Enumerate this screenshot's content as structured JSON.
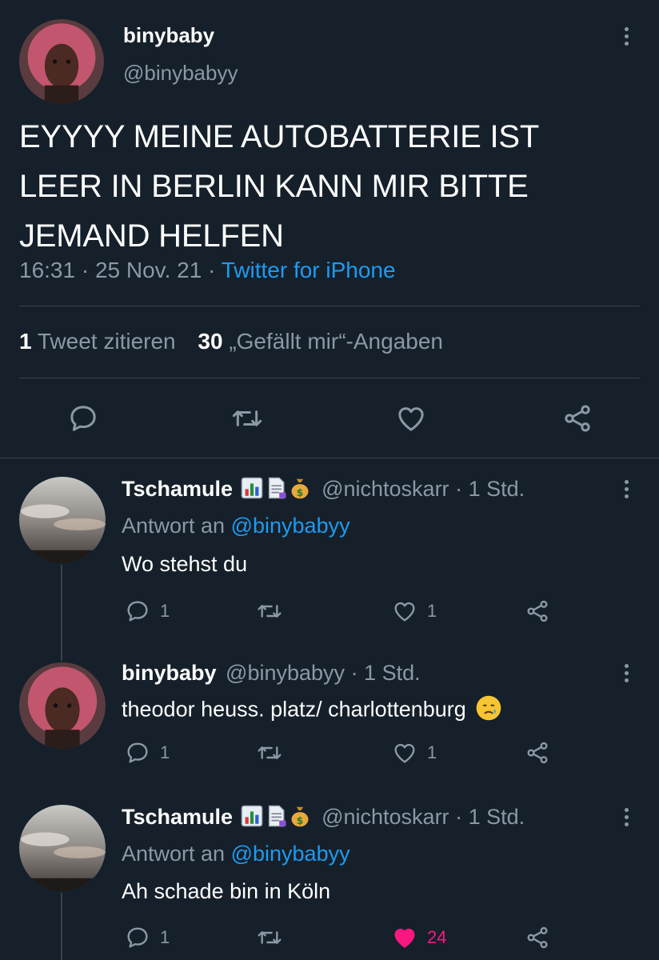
{
  "main_tweet": {
    "display_name": "binybaby",
    "handle": "@binybabyy",
    "text_lines": [
      "EYYYY MEINE AUTOBATTERIE IST",
      "LEER IN BERLIN KANN MIR BITTE",
      "JEMAND HELFEN"
    ],
    "time": "16:31",
    "separator": "·",
    "date": "25 Nov. 21",
    "source": "Twitter for iPhone",
    "stats": {
      "quotes_count": "1",
      "quotes_label": "Tweet zitieren",
      "likes_count": "30",
      "likes_label": "„Gefällt mir“-Angaben"
    }
  },
  "replies": [
    {
      "display_name": "Tschamule",
      "handle": "@nichtoskarr",
      "time": "· 1 Std.",
      "reply_to_label": "Antwort an",
      "reply_to_handle": "@binybabyy",
      "text": "Wo stehst du",
      "reply_count": "1",
      "like_count": "1",
      "liked": false
    },
    {
      "display_name": "binybaby",
      "handle": "@binybabyy",
      "time": "· 1 Std.",
      "text": "theodor heuss. platz/ charlottenburg",
      "reply_count": "1",
      "like_count": "1",
      "liked": false
    },
    {
      "display_name": "Tschamule",
      "handle": "@nichtoskarr",
      "time": "· 1 Std.",
      "reply_to_label": "Antwort an",
      "reply_to_handle": "@binybabyy",
      "text": "Ah schade bin in Köln",
      "reply_count": "1",
      "like_count": "24",
      "liked": true
    }
  ],
  "icons": [
    "reply-icon",
    "retweet-icon",
    "like-icon",
    "share-icon",
    "more-icon"
  ],
  "colors": {
    "background": "#15202b",
    "text": "#ffffff",
    "muted": "#8b98a5",
    "link": "#1d9bf0",
    "like": "#f91880",
    "divider": "#38444d"
  }
}
